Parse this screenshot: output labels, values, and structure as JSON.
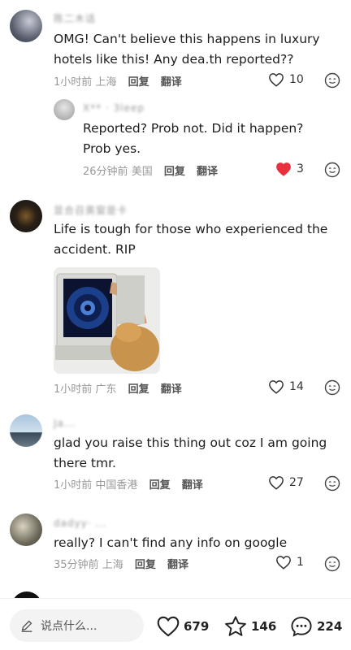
{
  "comments": [
    {
      "username": "陈二木话",
      "text": "OMG! Can't believe this happens in luxury hotels like this! Any dea.th reported??",
      "time": "1小时前",
      "location": "上海",
      "reply_label": "回复",
      "translate_label": "翻译",
      "likes": "10",
      "liked": false
    },
    {
      "username": "X** · 3leep",
      "text": "Reported? Prob not. Did it happen? Prob yes.",
      "time": "26分钟前",
      "location": "美国",
      "reply_label": "回复",
      "translate_label": "翻译",
      "likes": "3",
      "liked": true
    },
    {
      "username": "显合召奥窗是卡",
      "text": "Life is tough for those who experienced the accident. RIP",
      "time": "1小时前",
      "location": "广东",
      "reply_label": "回复",
      "translate_label": "翻译",
      "likes": "14",
      "liked": false
    },
    {
      "username": "Ja...",
      "text": "glad you raise this thing out coz I am going there tmr.",
      "time": "1小时前",
      "location": "中国香港",
      "reply_label": "回复",
      "translate_label": "翻译",
      "likes": "27",
      "liked": false
    },
    {
      "username": "dadyy· ...",
      "text": "really? I can't find any info on google",
      "time": "35分钟前",
      "location": "上海",
      "reply_label": "回复",
      "translate_label": "翻译",
      "likes": "1",
      "liked": false
    }
  ],
  "bottom_bar": {
    "input_placeholder": "说点什么...",
    "like_count": "679",
    "star_count": "146",
    "comment_count": "224"
  },
  "colors": {
    "liked_red": "#e8303f",
    "muted_text": "#999999"
  },
  "icons": [
    "heart-icon",
    "more-icon",
    "pencil-icon",
    "star-icon",
    "comment-icon"
  ]
}
